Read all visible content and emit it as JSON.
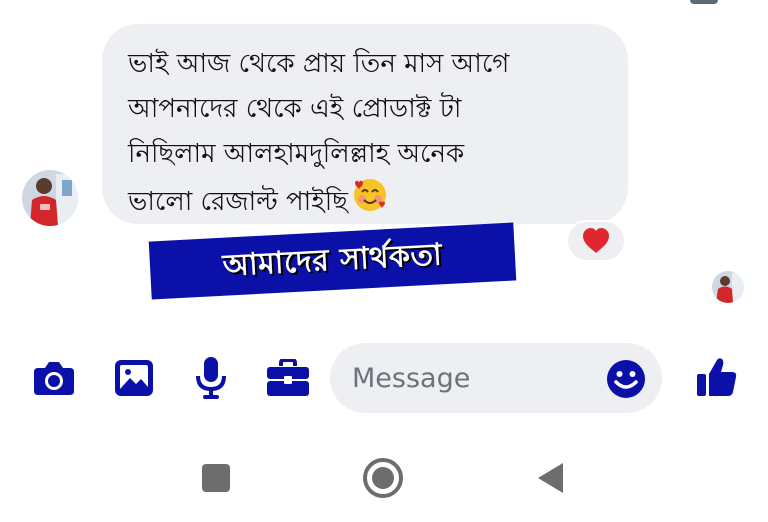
{
  "conversation": {
    "message": {
      "text": "ভাই আজ থেকে প্রায় তিন মাস আগে\nআপনাদের থেকে এই প্রোডাক্ট টা\nনিছিলাম আলহামদুলিল্লাহ অনেক\nভালো রেজাল্ট পাইছি",
      "emoji": "smiling-face-with-hearts"
    },
    "reaction": "red-heart"
  },
  "banner": {
    "text": "আমাদের সার্থকতা"
  },
  "composer": {
    "placeholder": "Message",
    "value": "",
    "icons": [
      "camera-icon",
      "image-icon",
      "microphone-icon",
      "briefcase-icon",
      "emoji-icon",
      "thumbs-up-icon"
    ]
  },
  "navbar": {
    "buttons": [
      "recents",
      "home",
      "back"
    ]
  },
  "colors": {
    "accent": "#0b11a8",
    "bubble": "#eeeff3",
    "nav": "#6d6d6d",
    "heart": "#e0262e"
  }
}
